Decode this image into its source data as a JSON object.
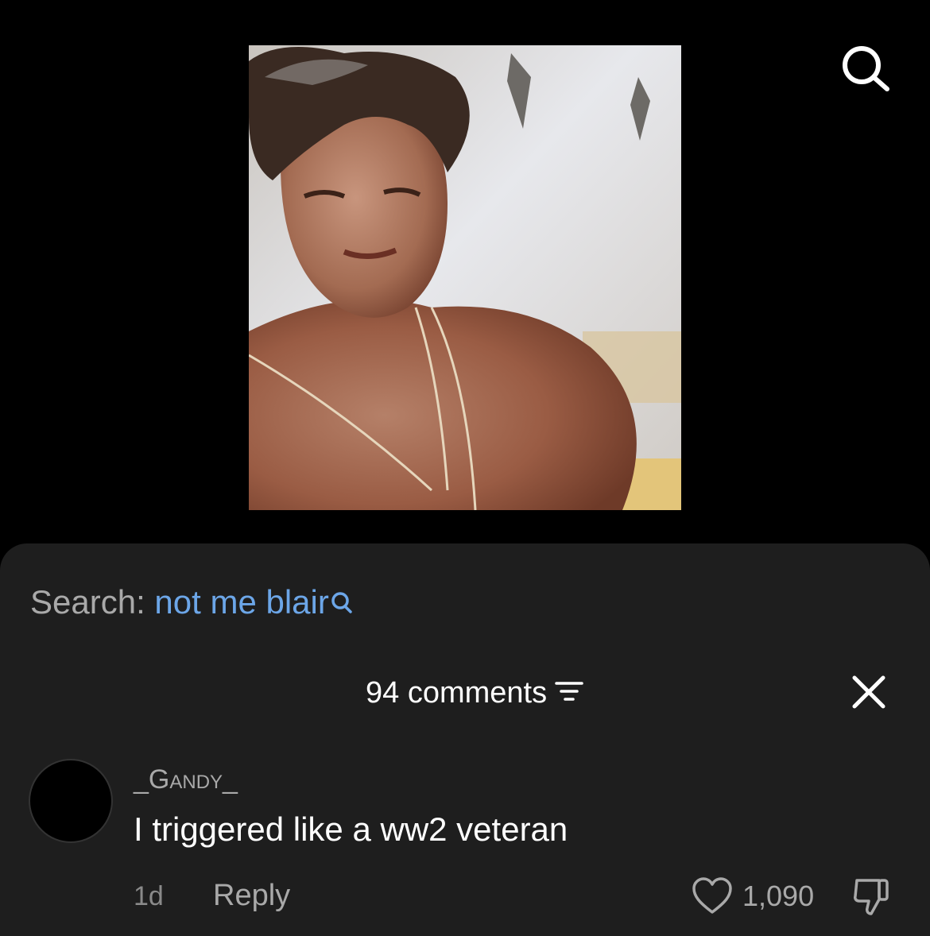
{
  "video": {
    "thumbnail_icon": "video-thumbnail-image"
  },
  "top_search": {
    "icon": "search-icon"
  },
  "search": {
    "prefix": "Search:",
    "query": "not me blair",
    "query_icon": "search-icon"
  },
  "comments": {
    "count_label": "94 comments",
    "filter_icon": "filter-icon",
    "close_icon": "close-icon"
  },
  "comment": {
    "username": "_Gandy_",
    "text": "I triggered like a ww2 veteran",
    "time": "1d",
    "reply_label": "Reply",
    "likes": "1,090",
    "like_icon": "heart-icon",
    "dislike_icon": "thumbs-down-icon"
  },
  "colors": {
    "background": "#000000",
    "sheet": "#1e1e1e",
    "link": "#6ca6e8",
    "muted_text": "#a9a9a9",
    "primary_text": "#ffffff"
  }
}
